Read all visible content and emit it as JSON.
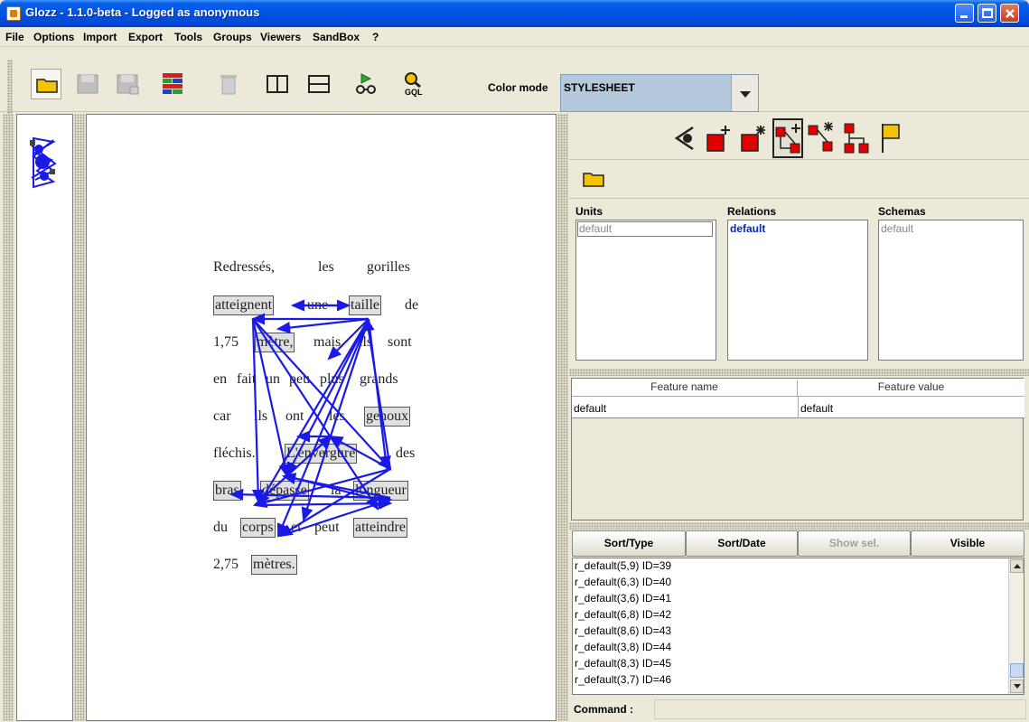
{
  "window": {
    "title": "Glozz - 1.1.0-beta - Logged as anonymous"
  },
  "menu": [
    "File",
    "Options",
    "Import",
    "Export",
    "Tools",
    "Groups",
    "Viewers",
    "SandBox",
    "?"
  ],
  "toolbar": {
    "color_mode_label": "Color mode",
    "color_mode_value": "STYLESHEET",
    "gql_label": "GQL"
  },
  "document": {
    "lines": [
      [
        "Redressés,",
        "les",
        "gorilles"
      ],
      [
        "atteignent",
        "une",
        "taille",
        "de"
      ],
      [
        "1,75",
        "mètre,",
        "mais",
        "ils",
        "sont"
      ],
      [
        "en",
        "fait",
        "un",
        "peu",
        "plus",
        "grands"
      ],
      [
        "car",
        "ils",
        "ont",
        "les",
        "genoux"
      ],
      [
        "fléchis.",
        "L'envergure",
        "des"
      ],
      [
        "bras",
        "dépasse",
        "la",
        "longueur"
      ],
      [
        "du",
        "corps",
        "et",
        "peut",
        "atteindre"
      ],
      [
        "2,75",
        "mètres."
      ]
    ]
  },
  "panels": {
    "units_label": "Units",
    "relations_label": "Relations",
    "schemas_label": "Schemas",
    "units_value": "default",
    "relations_value": "default",
    "schemas_value": "default"
  },
  "features": {
    "col_name": "Feature name",
    "col_value": "Feature value",
    "row_name": "default",
    "row_value": "default"
  },
  "sort_buttons": [
    "Sort/Type",
    "Sort/Date",
    "Show sel.",
    "Visible"
  ],
  "relations_list": [
    "r_default(5,9) ID=39",
    "r_default(6,3) ID=40",
    "r_default(3,6) ID=41",
    "r_default(6,8) ID=42",
    "r_default(8,6) ID=43",
    "r_default(3,8) ID=44",
    "r_default(8,3) ID=45",
    "r_default(3,7) ID=46"
  ],
  "command_label": "Command :",
  "colors": {
    "relation_arrow": "#1a1ae6",
    "unit_fill": "#e0e0e0",
    "selected_relation_text": "#0027c8",
    "titlebar_blue": "#0055e5"
  },
  "icons": {
    "tool_icons": [
      "eye-icon",
      "add-unit-icon",
      "select-unit-icon",
      "add-relation-icon",
      "select-relation-icon",
      "schema-icon",
      "flag-icon"
    ]
  }
}
